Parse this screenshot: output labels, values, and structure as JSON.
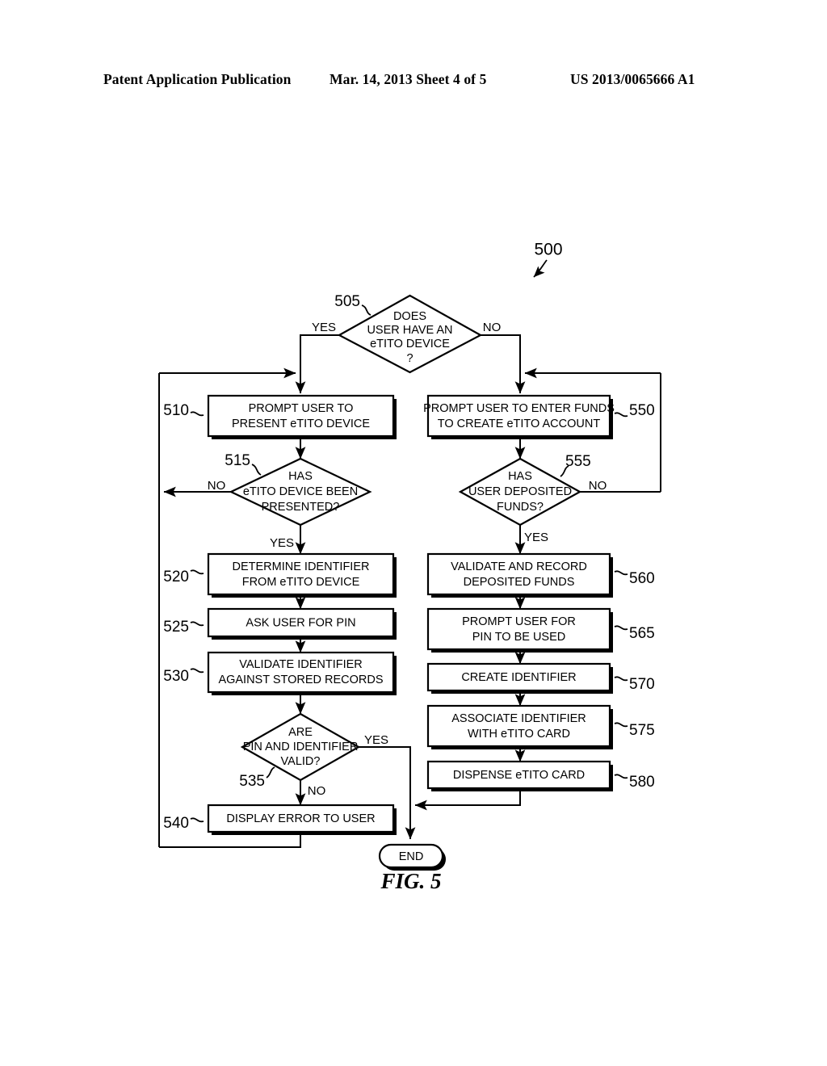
{
  "header": {
    "left": "Patent Application Publication",
    "middle": "Mar. 14, 2013  Sheet 4 of 5",
    "right": "US 2013/0065666 A1"
  },
  "figure": {
    "caption": "FIG. 5",
    "diagram_number": "500",
    "end_label": "END"
  },
  "chart_data": {
    "type": "flowchart",
    "title": "FIG. 5",
    "diagram_ref": "500",
    "nodes": [
      {
        "ref": "505",
        "shape": "decision",
        "text": [
          "DOES",
          "USER HAVE AN",
          "eTITO DEVICE",
          "?"
        ]
      },
      {
        "ref": "510",
        "shape": "process",
        "text": [
          "PROMPT USER TO",
          "PRESENT eTITO DEVICE"
        ]
      },
      {
        "ref": "515",
        "shape": "decision",
        "text": [
          "HAS",
          "eTITO DEVICE BEEN",
          "PRESENTED?"
        ]
      },
      {
        "ref": "520",
        "shape": "process",
        "text": [
          "DETERMINE IDENTIFIER",
          "FROM eTITO DEVICE"
        ]
      },
      {
        "ref": "525",
        "shape": "process",
        "text": [
          "ASK USER FOR PIN"
        ]
      },
      {
        "ref": "530",
        "shape": "process",
        "text": [
          "VALIDATE IDENTIFIER",
          "AGAINST STORED RECORDS"
        ]
      },
      {
        "ref": "535",
        "shape": "decision",
        "text": [
          "ARE",
          "PIN AND IDENTIFIER",
          "VALID?"
        ]
      },
      {
        "ref": "540",
        "shape": "process",
        "text": [
          "DISPLAY ERROR TO USER"
        ]
      },
      {
        "ref": "550",
        "shape": "process",
        "text": [
          "PROMPT USER TO ENTER FUNDS",
          "TO CREATE eTITO ACCOUNT"
        ]
      },
      {
        "ref": "555",
        "shape": "decision",
        "text": [
          "HAS",
          "USER DEPOSITED",
          "FUNDS?"
        ]
      },
      {
        "ref": "560",
        "shape": "process",
        "text": [
          "VALIDATE AND RECORD",
          "DEPOSITED FUNDS"
        ]
      },
      {
        "ref": "565",
        "shape": "process",
        "text": [
          "PROMPT USER FOR",
          "PIN TO BE USED"
        ]
      },
      {
        "ref": "570",
        "shape": "process",
        "text": [
          "CREATE IDENTIFIER"
        ]
      },
      {
        "ref": "575",
        "shape": "process",
        "text": [
          "ASSOCIATE IDENTIFIER",
          "WITH eTITO CARD"
        ]
      },
      {
        "ref": "580",
        "shape": "process",
        "text": [
          "DISPENSE eTITO CARD"
        ]
      },
      {
        "ref": "END",
        "shape": "terminator",
        "text": [
          "END"
        ]
      }
    ],
    "edges": [
      {
        "from": "505",
        "to": "510",
        "label": "YES"
      },
      {
        "from": "505",
        "to": "550",
        "label": "NO"
      },
      {
        "from": "510",
        "to": "515",
        "label": ""
      },
      {
        "from": "515",
        "to": "510",
        "label": "NO"
      },
      {
        "from": "515",
        "to": "520",
        "label": "YES"
      },
      {
        "from": "520",
        "to": "525",
        "label": ""
      },
      {
        "from": "525",
        "to": "530",
        "label": ""
      },
      {
        "from": "530",
        "to": "535",
        "label": ""
      },
      {
        "from": "535",
        "to": "END",
        "label": "YES"
      },
      {
        "from": "535",
        "to": "540",
        "label": "NO"
      },
      {
        "from": "540",
        "to": "510",
        "label": ""
      },
      {
        "from": "550",
        "to": "555",
        "label": ""
      },
      {
        "from": "555",
        "to": "550",
        "label": "NO"
      },
      {
        "from": "555",
        "to": "560",
        "label": "YES"
      },
      {
        "from": "560",
        "to": "565",
        "label": ""
      },
      {
        "from": "565",
        "to": "570",
        "label": ""
      },
      {
        "from": "570",
        "to": "575",
        "label": ""
      },
      {
        "from": "575",
        "to": "580",
        "label": ""
      },
      {
        "from": "580",
        "to": "END",
        "label": ""
      }
    ]
  },
  "nodes": {
    "n505": {
      "ref": "505",
      "l1": "DOES",
      "l2": "USER HAVE AN",
      "l3": "eTITO DEVICE",
      "l4": "?"
    },
    "n510": {
      "ref": "510",
      "l1": "PROMPT USER TO",
      "l2": "PRESENT eTITO DEVICE"
    },
    "n515": {
      "ref": "515",
      "l1": "HAS",
      "l2": "eTITO DEVICE BEEN",
      "l3": "PRESENTED?"
    },
    "n520": {
      "ref": "520",
      "l1": "DETERMINE IDENTIFIER",
      "l2": "FROM eTITO DEVICE"
    },
    "n525": {
      "ref": "525",
      "l1": "ASK USER FOR PIN"
    },
    "n530": {
      "ref": "530",
      "l1": "VALIDATE IDENTIFIER",
      "l2": "AGAINST STORED RECORDS"
    },
    "n535": {
      "ref": "535",
      "l1": "ARE",
      "l2": "PIN AND IDENTIFIER",
      "l3": "VALID?"
    },
    "n540": {
      "ref": "540",
      "l1": "DISPLAY ERROR TO USER"
    },
    "n550": {
      "ref": "550",
      "l1": "PROMPT USER TO ENTER FUNDS",
      "l2": "TO CREATE eTITO ACCOUNT"
    },
    "n555": {
      "ref": "555",
      "l1": "HAS",
      "l2": "USER DEPOSITED",
      "l3": "FUNDS?"
    },
    "n560": {
      "ref": "560",
      "l1": "VALIDATE AND RECORD",
      "l2": "DEPOSITED FUNDS"
    },
    "n565": {
      "ref": "565",
      "l1": "PROMPT USER FOR",
      "l2": "PIN TO BE USED"
    },
    "n570": {
      "ref": "570",
      "l1": "CREATE IDENTIFIER"
    },
    "n575": {
      "ref": "575",
      "l1": "ASSOCIATE IDENTIFIER",
      "l2": "WITH eTITO CARD"
    },
    "n580": {
      "ref": "580",
      "l1": "DISPENSE eTITO CARD"
    }
  },
  "labels": {
    "yes_505": "YES",
    "no_505": "NO",
    "no_515": "NO",
    "yes_515": "YES",
    "yes_535": "YES",
    "no_535": "NO",
    "no_555": "NO",
    "yes_555": "YES"
  }
}
